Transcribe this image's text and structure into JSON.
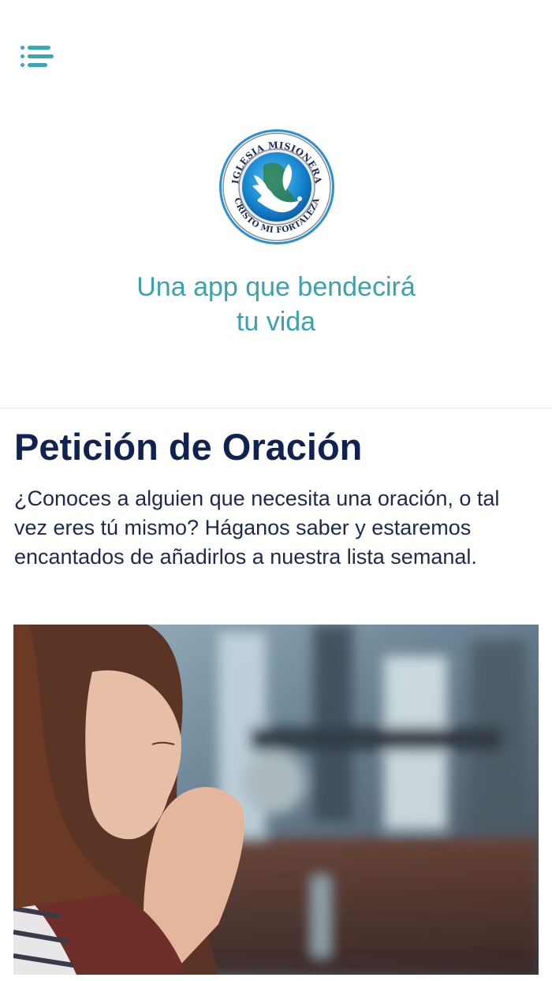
{
  "header": {
    "menu_icon": "hamburger-menu-icon",
    "logo": {
      "top_text": "IGLESIA MISIONERA",
      "bottom_text": "CRISTO MI FORTALEZA",
      "icon": "dove-globe-logo"
    },
    "tagline_line1": "Una app que bendecirá",
    "tagline_line2": "tu vida"
  },
  "section": {
    "title": "Petición de Oración",
    "description": "¿Conoces a alguien que necesita una oración, o tal vez eres tú mismo? Háganos saber y estaremos encantados de añadirlos a nuestra lista semanal.",
    "image": "woman-praying-photo"
  },
  "colors": {
    "accent": "#3aa7b3",
    "title": "#0f2251",
    "text": "#1b2a4e",
    "logo_ring": "#1a8fd6"
  }
}
